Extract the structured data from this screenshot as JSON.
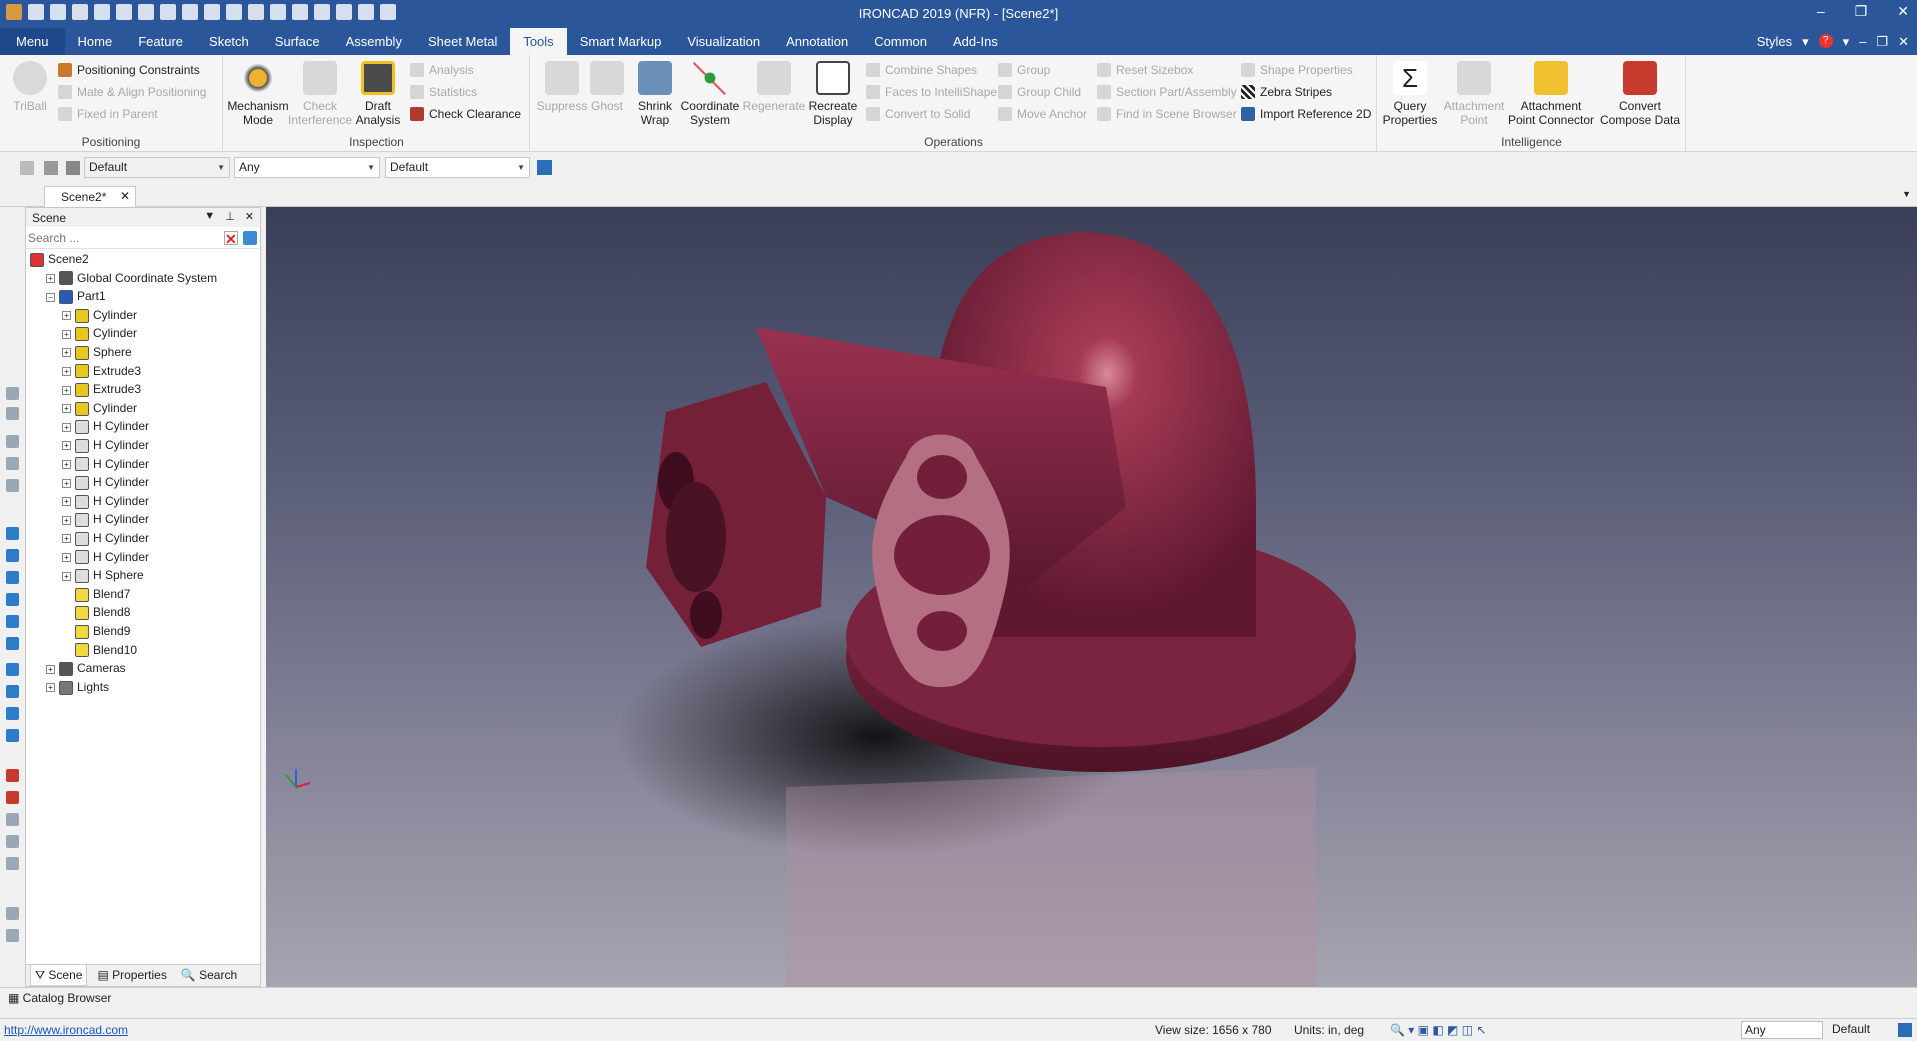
{
  "title": "IRONCAD 2019 (NFR) - [Scene2*]",
  "menubar": {
    "tabs": [
      "Menu",
      "Home",
      "Feature",
      "Sketch",
      "Surface",
      "Assembly",
      "Sheet Metal",
      "Tools",
      "Smart Markup",
      "Visualization",
      "Annotation",
      "Common",
      "Add-Ins"
    ],
    "active_tab": "Tools",
    "styles_label": "Styles"
  },
  "ribbon": {
    "positioning": {
      "label": "Positioning",
      "triball": "TriBall",
      "items": [
        "Positioning Constraints",
        "Mate & Align Positioning",
        "Fixed in Parent"
      ]
    },
    "inspection": {
      "label": "Inspection",
      "mechanism": [
        "Mechanism",
        "Mode"
      ],
      "check_interference": [
        "Check",
        "Interference"
      ],
      "draft_analysis": [
        "Draft",
        "Analysis"
      ],
      "items": [
        "Analysis",
        "Statistics",
        "Check Clearance"
      ]
    },
    "operations": {
      "label": "Operations",
      "suppress": "Suppress",
      "ghost": "Ghost",
      "shrink_wrap": [
        "Shrink",
        "Wrap"
      ],
      "coordinate_system": [
        "Coordinate",
        "System"
      ],
      "regenerate": "Regenerate",
      "recreate_display": [
        "Recreate",
        "Display"
      ],
      "col1": [
        "Combine Shapes",
        "Faces to IntelliShape",
        "Convert to Solid"
      ],
      "col2": [
        "Group",
        "Group Child",
        "Move Anchor"
      ],
      "col3": [
        "Reset Sizebox",
        "Section Part/Assembly",
        "Find in Scene Browser"
      ],
      "col4": [
        "Shape Properties",
        "Zebra Stripes",
        "Import Reference 2D"
      ]
    },
    "intelligence": {
      "label": "Intelligence",
      "query_properties": [
        "Query",
        "Properties"
      ],
      "attachment_point": [
        "Attachment",
        "Point"
      ],
      "attachment_point_connector": [
        "Attachment",
        "Point Connector"
      ],
      "convert_compose_data": [
        "Convert",
        "Compose Data"
      ]
    }
  },
  "toolbar2": {
    "style_select": "Default",
    "filter_select": "Any",
    "mode_select": "Default"
  },
  "doc_tab": "Scene2*",
  "scene_panel": {
    "title": "Scene",
    "search_placeholder": "Search ...",
    "tree": [
      {
        "label": "Scene2",
        "level": 0,
        "icon": "scene-icon"
      },
      {
        "label": "Global Coordinate System",
        "level": 1,
        "icon": "axes-icon"
      },
      {
        "label": "Part1",
        "level": 1,
        "icon": "part-icon"
      },
      {
        "label": "Cylinder",
        "level": 2,
        "icon": "shape-icon"
      },
      {
        "label": "Cylinder",
        "level": 2,
        "icon": "shape-icon"
      },
      {
        "label": "Sphere",
        "level": 2,
        "icon": "sphere-icon"
      },
      {
        "label": "Extrude3",
        "level": 2,
        "icon": "shape-icon"
      },
      {
        "label": "Extrude3",
        "level": 2,
        "icon": "shape-icon"
      },
      {
        "label": "Cylinder",
        "level": 2,
        "icon": "shape-icon"
      },
      {
        "label": "H Cylinder",
        "level": 2,
        "icon": "hole-icon"
      },
      {
        "label": "H Cylinder",
        "level": 2,
        "icon": "hole-icon"
      },
      {
        "label": "H Cylinder",
        "level": 2,
        "icon": "hole-icon"
      },
      {
        "label": "H Cylinder",
        "level": 2,
        "icon": "hole-icon"
      },
      {
        "label": "H Cylinder",
        "level": 2,
        "icon": "hole-icon"
      },
      {
        "label": "H Cylinder",
        "level": 2,
        "icon": "hole-icon"
      },
      {
        "label": "H Cylinder",
        "level": 2,
        "icon": "hole-icon"
      },
      {
        "label": "H Cylinder",
        "level": 2,
        "icon": "hole-icon"
      },
      {
        "label": "H Sphere",
        "level": 2,
        "icon": "hole-sphere-icon"
      },
      {
        "label": "Blend7",
        "level": 2,
        "icon": "blend-icon"
      },
      {
        "label": "Blend8",
        "level": 2,
        "icon": "blend-icon"
      },
      {
        "label": "Blend9",
        "level": 2,
        "icon": "blend-icon"
      },
      {
        "label": "Blend10",
        "level": 2,
        "icon": "blend-icon"
      },
      {
        "label": "Cameras",
        "level": 1,
        "icon": "camera-icon"
      },
      {
        "label": "Lights",
        "level": 1,
        "icon": "light-icon"
      }
    ],
    "tabs": [
      "Scene",
      "Properties",
      "Search"
    ]
  },
  "catalog_browser": "Catalog Browser",
  "status": {
    "url": "http://www.ironcad.com",
    "view_size": "View size: 1656 x 780",
    "units": "Units: in, deg",
    "filter": "Any",
    "mode": "Default"
  },
  "colors": {
    "accent": "#2b579a",
    "part": "#7a2035"
  }
}
